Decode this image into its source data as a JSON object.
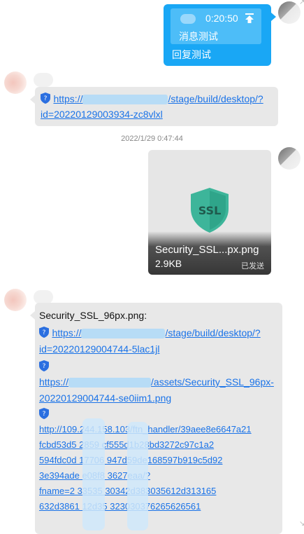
{
  "messages": {
    "m1": {
      "time": "0:20:50",
      "quoted_text": "消息测试",
      "reply_text": "回复测试"
    },
    "m2": {
      "link": "https://",
      "link_tail": "/stage/build/desktop/?",
      "link_line2": "id=20220129003934-zc8vlxl"
    },
    "timestamp": "2022/1/29 0:47:44",
    "m3": {
      "file_name": "Security_SSL...px.png",
      "file_size": "2.9KB",
      "status": "已发送",
      "thumb_text": "SSL"
    },
    "m4": {
      "title": "Security_SSL_96px.png:",
      "link1_head": "https://",
      "link1_tail": "/stage/build/desktop/?",
      "link1_line2": "id=20220129004744-5lac1jl",
      "link2_head": "https://",
      "link2_tail": "/assets/Security_SSL_96px-",
      "link2_line2": "20220129004744-se0iim1.png",
      "link3_lines": [
        "http://109.244.158.103/ftn_handler/39aee8e6647a21",
        "fcbd53d5      2859      cf555d1b28bd3272c97c1a2",
        "594fdc0d      17706      947d59de168597b919c5d92",
        "3e394ade      e08f8      3627eaa/?",
        "fname=2      33535      30342d383035612d313165",
        "632d3861      12d35      323030376265626561"
      ]
    }
  },
  "colors": {
    "blue_bubble": "#19a7f5",
    "gray_bubble": "#e8e8e8",
    "link": "#1a73e8",
    "ssl_shield": "#3db59a"
  },
  "icons": {
    "pin": "pin-top-icon",
    "shield": "shield-link-icon"
  }
}
